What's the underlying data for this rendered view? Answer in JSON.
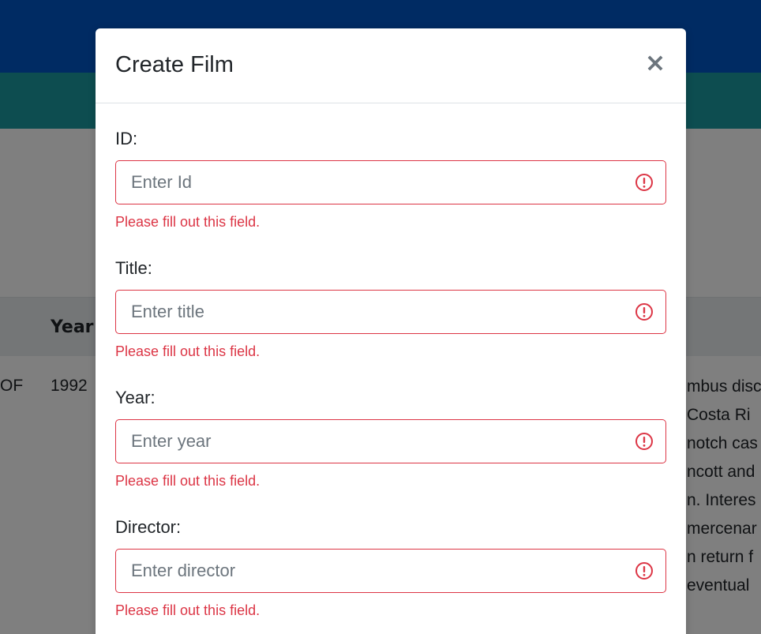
{
  "background": {
    "table": {
      "year_header": "Year",
      "row": {
        "title_fragment": "OF",
        "year": "1992",
        "description_lines": [
          "mbus disc",
          "Costa Ri",
          "notch cas",
          "ncott and",
          "n. Interes",
          "mercenar",
          "n return f",
          "eventual"
        ]
      }
    }
  },
  "modal": {
    "title": "Create Film",
    "close_label": "×",
    "fields": [
      {
        "label": "ID:",
        "placeholder": "Enter Id",
        "value": "",
        "error": "Please fill out this field."
      },
      {
        "label": "Title:",
        "placeholder": "Enter title",
        "value": "",
        "error": "Please fill out this field."
      },
      {
        "label": "Year:",
        "placeholder": "Enter year",
        "value": "",
        "error": "Please fill out this field."
      },
      {
        "label": "Director:",
        "placeholder": "Enter director",
        "value": "",
        "error": "Please fill out this field."
      }
    ]
  },
  "colors": {
    "header_blue": "#0056c7",
    "navbar_teal": "#1a9aa0",
    "error_red": "#dc3545"
  },
  "icons": {
    "invalid_field": "exclamation-circle-icon"
  }
}
